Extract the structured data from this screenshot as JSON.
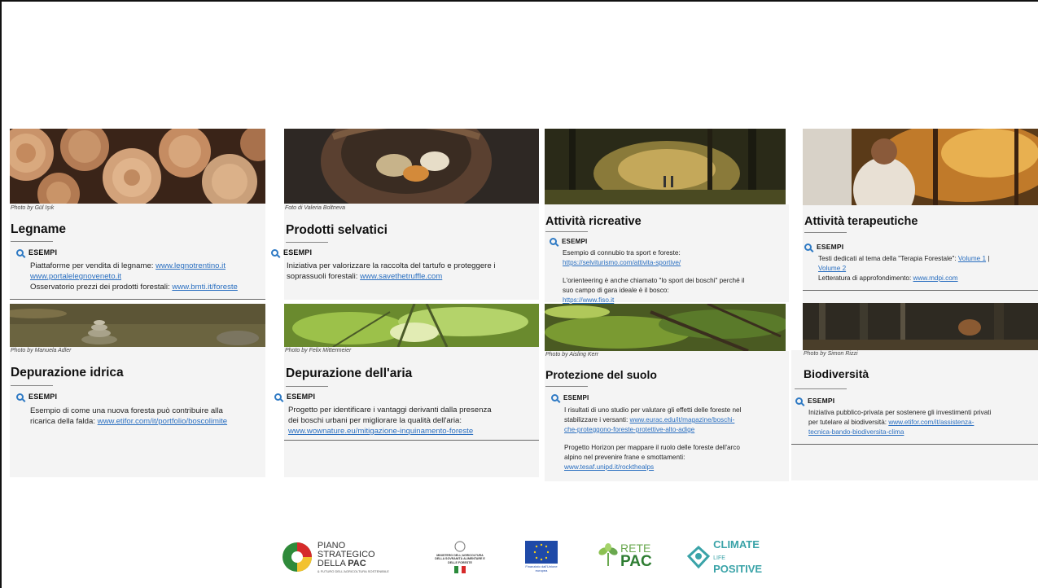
{
  "cards": [
    {
      "title": "Legname",
      "credit": "Photo by Gül Işık",
      "examples_label": "ESEMPI",
      "lines": [
        {
          "text": "Piattaforme per vendita di legname: ",
          "link": "www.legnotrentino.it"
        },
        {
          "text": "",
          "link": "www.portalelegnoveneto.it"
        },
        {
          "text": "Osservatorio prezzi dei prodotti forestali: ",
          "link": "www.bmti.it/foreste"
        }
      ]
    },
    {
      "title": "Prodotti selvatici",
      "credit": "Foto di Valeria Boltneva",
      "examples_label": "ESEMPI",
      "lines": [
        {
          "text": "Iniziativa per valorizzare la raccolta del tartufo e proteggere i",
          "link": ""
        },
        {
          "text": "soprassuoli forestali: ",
          "link": "www.savethetruffle.com"
        }
      ]
    },
    {
      "title": "Attività ricreative",
      "credit": "",
      "examples_label": "ESEMPI",
      "lines": [
        {
          "text": "Esempio di connubio tra sport e foreste:",
          "link": ""
        },
        {
          "text": "",
          "link": "https://selviturismo.com/attivita-sportive/"
        },
        {
          "text": "",
          "link": ""
        },
        {
          "text": "L'orienteering è anche chiamato \"lo sport dei boschi\" perché il",
          "link": ""
        },
        {
          "text": "suo campo di gara ideale è il bosco:",
          "link": ""
        },
        {
          "text": "",
          "link": "https://www.fiso.it"
        }
      ]
    },
    {
      "title": "Attività terapeutiche",
      "credit": "",
      "examples_label": "ESEMPI",
      "lines": [
        {
          "text": "Testi dedicati al tema della \"Terapia Forestale\": ",
          "link": "Volume 1",
          "after": " |"
        },
        {
          "text": "",
          "link": "Volume 2"
        },
        {
          "text": "Letteratura di approfondimento: ",
          "link": "www.mdpi.com"
        }
      ]
    },
    {
      "title": "Depurazione idrica",
      "credit": "Photo by Manuela Adler",
      "examples_label": "ESEMPI",
      "lines": [
        {
          "text": "Esempio di come una nuova foresta può contribuire alla",
          "link": ""
        },
        {
          "text": "ricarica della falda: ",
          "link": "www.etifor.com/it/portfolio/boscolimite"
        }
      ]
    },
    {
      "title": "Depurazione dell'aria",
      "credit": "Photo by Felix Mittermeier",
      "examples_label": "ESEMPI",
      "lines": [
        {
          "text": "Progetto per identificare i vantaggi derivanti dalla presenza",
          "link": ""
        },
        {
          "text": "dei boschi urbani per migliorare la qualità dell'aria:",
          "link": ""
        },
        {
          "text": "",
          "link": "www.wownature.eu/mitigazione-inquinamento-foreste"
        }
      ]
    },
    {
      "title": "Protezione del suolo",
      "credit": "Photo by Aisling Kerr",
      "examples_label": "ESEMPI",
      "lines": [
        {
          "text": "I risultati di uno studio per valutare gli effetti delle foreste nel",
          "link": ""
        },
        {
          "text": "stabilizzare i versanti: ",
          "link": "www.eurac.edu/it/magazine/boschi-"
        },
        {
          "text": "",
          "link": "che-proteggono-foreste-protettive-alto-adige"
        },
        {
          "text": "",
          "link": ""
        },
        {
          "text": "Progetto Horizon per mappare il ruolo delle foreste dell'arco",
          "link": ""
        },
        {
          "text": "alpino nel prevenire frane e smottamenti:",
          "link": ""
        },
        {
          "text": "",
          "link": "www.tesaf.unipd.it/rockthealps"
        }
      ]
    },
    {
      "title": "Biodiversità",
      "credit": "Photo by Simon Rizzi",
      "examples_label": "ESEMPI",
      "lines": [
        {
          "text": "Iniziativa pubblico-privata per sostenere gli investimenti privati",
          "link": ""
        },
        {
          "text": "per tutelare al biodiversità: ",
          "link": "www.etifor.com/it/assistenza-"
        },
        {
          "text": "",
          "link": "tecnica-bando-biodiversita-clima"
        }
      ]
    }
  ],
  "logos": {
    "pac_line1": "PIANO STRATEGICO",
    "pac_line2": "DELLA",
    "pac_line2b": "PAC",
    "pac_line3": "& FUTURO DELL'AGRICOLTURA SOSTENIBILE",
    "ministry": "MINISTERO DELL'AGRICOLTURA DELLA SOVRANITÀ ALIMENTARE E DELLE FORESTE",
    "eu": "Finanziato dall'Unione europea",
    "rete_line1": "RETE",
    "rete_line2": "PAC",
    "climate_line1": "CLIMATE",
    "climate_line2": "POSITIVE",
    "climate_life": "LIFE"
  },
  "colors": {
    "link": "#2a6fc0",
    "icon": "#2f7ac4",
    "panel": "#f4f4f4"
  }
}
